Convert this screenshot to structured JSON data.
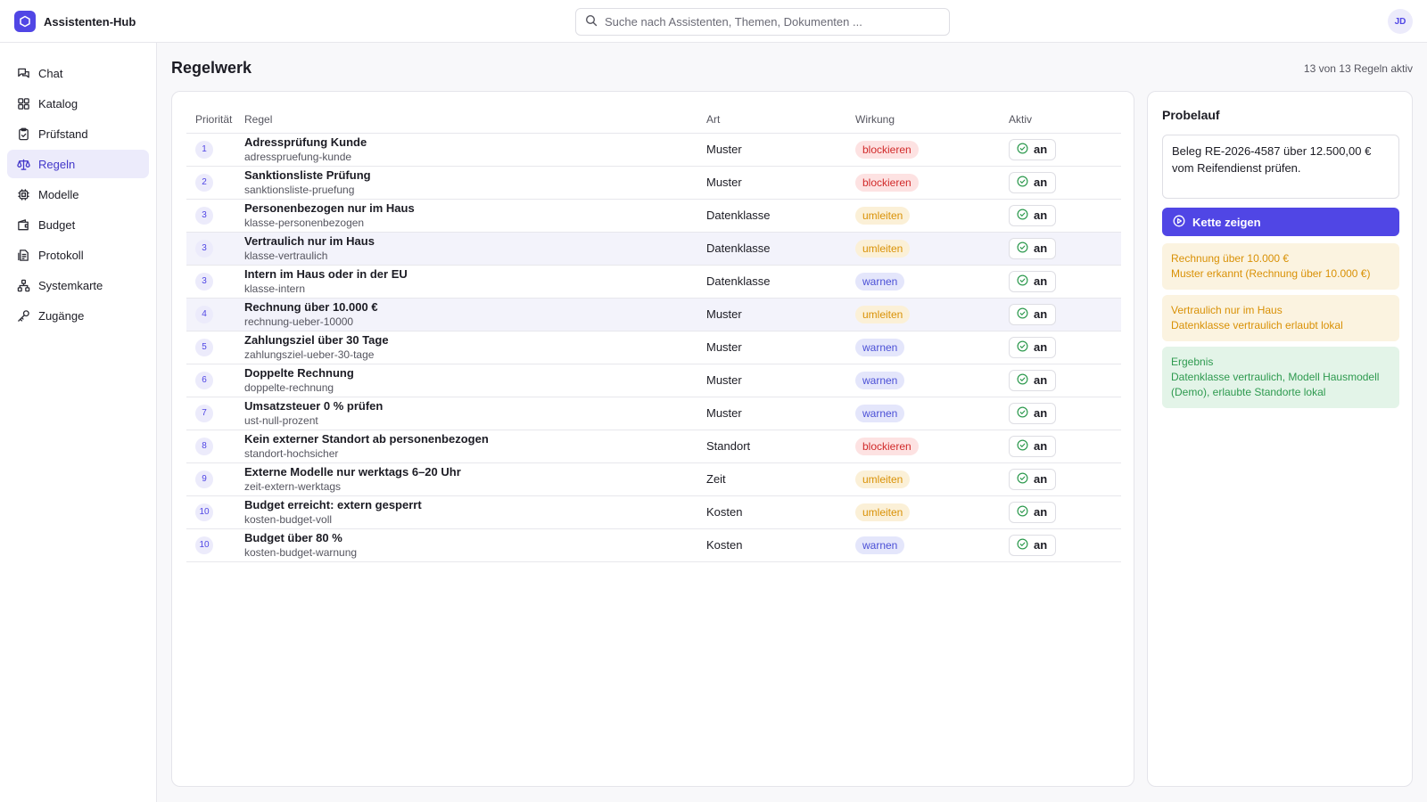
{
  "app": {
    "name": "Assistenten-Hub",
    "user_initials": "JD"
  },
  "search": {
    "placeholder": "Suche nach Assistenten, Themen, Dokumenten ..."
  },
  "sidebar": {
    "items": [
      {
        "label": "Chat",
        "icon": "chat-icon"
      },
      {
        "label": "Katalog",
        "icon": "grid-icon"
      },
      {
        "label": "Prüfstand",
        "icon": "clipboard-check-icon"
      },
      {
        "label": "Regeln",
        "icon": "scale-icon",
        "active": true
      },
      {
        "label": "Modelle",
        "icon": "chip-icon"
      },
      {
        "label": "Budget",
        "icon": "wallet-icon"
      },
      {
        "label": "Protokoll",
        "icon": "log-icon"
      },
      {
        "label": "Systemkarte",
        "icon": "network-icon"
      },
      {
        "label": "Zugänge",
        "icon": "key-icon"
      }
    ]
  },
  "page": {
    "title": "Regelwerk",
    "count_label": "13 von 13 Regeln aktiv"
  },
  "table": {
    "headers": {
      "prio": "Priorität",
      "rule": "Regel",
      "art": "Art",
      "wirkung": "Wirkung",
      "aktiv": "Aktiv"
    },
    "rows": [
      {
        "prio": "1",
        "title": "Adressprüfung Kunde",
        "slug": "adresspruefung-kunde",
        "art": "Muster",
        "wirkung": "blockieren",
        "tone": "red",
        "aktiv": "an"
      },
      {
        "prio": "2",
        "title": "Sanktionsliste Prüfung",
        "slug": "sanktionsliste-pruefung",
        "art": "Muster",
        "wirkung": "blockieren",
        "tone": "red",
        "aktiv": "an"
      },
      {
        "prio": "3",
        "title": "Personenbezogen nur im Haus",
        "slug": "klasse-personenbezogen",
        "art": "Datenklasse",
        "wirkung": "umleiten",
        "tone": "amber",
        "aktiv": "an"
      },
      {
        "prio": "3",
        "title": "Vertraulich nur im Haus",
        "slug": "klasse-vertraulich",
        "art": "Datenklasse",
        "wirkung": "umleiten",
        "tone": "amber",
        "aktiv": "an",
        "highlight": true
      },
      {
        "prio": "3",
        "title": "Intern im Haus oder in der EU",
        "slug": "klasse-intern",
        "art": "Datenklasse",
        "wirkung": "warnen",
        "tone": "blue",
        "aktiv": "an"
      },
      {
        "prio": "4",
        "title": "Rechnung über 10.000 €",
        "slug": "rechnung-ueber-10000",
        "art": "Muster",
        "wirkung": "umleiten",
        "tone": "amber",
        "aktiv": "an",
        "highlight": true
      },
      {
        "prio": "5",
        "title": "Zahlungsziel über 30 Tage",
        "slug": "zahlungsziel-ueber-30-tage",
        "art": "Muster",
        "wirkung": "warnen",
        "tone": "blue",
        "aktiv": "an"
      },
      {
        "prio": "6",
        "title": "Doppelte Rechnung",
        "slug": "doppelte-rechnung",
        "art": "Muster",
        "wirkung": "warnen",
        "tone": "blue",
        "aktiv": "an"
      },
      {
        "prio": "7",
        "title": "Umsatzsteuer 0 % prüfen",
        "slug": "ust-null-prozent",
        "art": "Muster",
        "wirkung": "warnen",
        "tone": "blue",
        "aktiv": "an"
      },
      {
        "prio": "8",
        "title": "Kein externer Standort ab personenbezogen",
        "slug": "standort-hochsicher",
        "art": "Standort",
        "wirkung": "blockieren",
        "tone": "red",
        "aktiv": "an"
      },
      {
        "prio": "9",
        "title": "Externe Modelle nur werktags 6–20 Uhr",
        "slug": "zeit-extern-werktags",
        "art": "Zeit",
        "wirkung": "umleiten",
        "tone": "amber",
        "aktiv": "an"
      },
      {
        "prio": "10",
        "title": "Budget erreicht: extern gesperrt",
        "slug": "kosten-budget-voll",
        "art": "Kosten",
        "wirkung": "umleiten",
        "tone": "amber",
        "aktiv": "an"
      },
      {
        "prio": "10",
        "title": "Budget über 80 %",
        "slug": "kosten-budget-warnung",
        "art": "Kosten",
        "wirkung": "warnen",
        "tone": "blue",
        "aktiv": "an"
      }
    ]
  },
  "probe": {
    "title": "Probelauf",
    "input_value": "Beleg RE-2026-4587 über 12.500,00 € vom Reifendienst prüfen.",
    "button_label": "Kette zeigen",
    "steps": [
      {
        "title": "Rechnung über 10.000 €",
        "text": "Muster erkannt (Rechnung über 10.000 €)",
        "tone": "amber"
      },
      {
        "title": "Vertraulich nur im Haus",
        "text": "Datenklasse vertraulich erlaubt lokal",
        "tone": "amber"
      },
      {
        "title": "Ergebnis",
        "text": "Datenklasse vertraulich, Modell Hausmodell (Demo), erlaubte Standorte lokal",
        "tone": "green"
      }
    ]
  },
  "colors": {
    "accent": "#5046e5",
    "danger": "#d12a2a",
    "warning": "#d99106",
    "info": "#4b50d6",
    "success": "#2e9a4f"
  }
}
